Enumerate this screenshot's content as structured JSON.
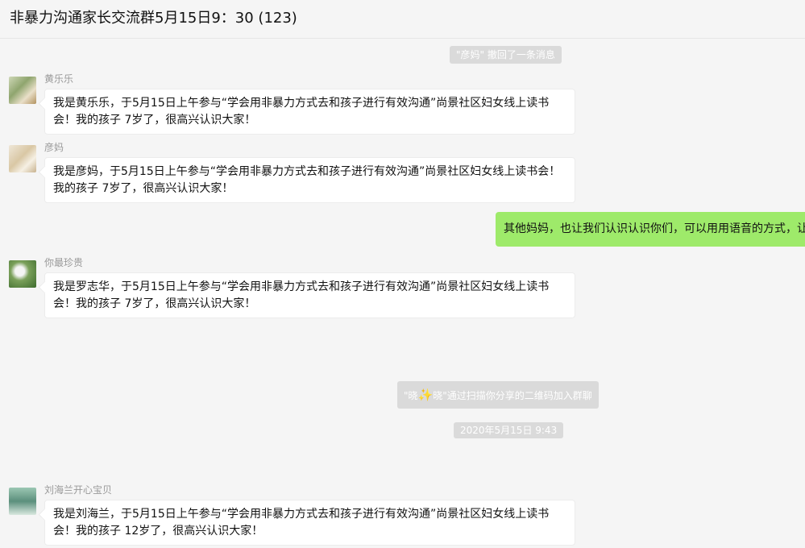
{
  "header": {
    "title": "非暴力沟通家长交流群5月15日9：30 (123)"
  },
  "notices": {
    "recall": "\"彦妈\" 撤回了一条消息",
    "join_prefix": "\"晓",
    "join_icon": "✨",
    "join_suffix": "晓\"通过扫描你分享的二维码加入群聊",
    "timestamp": "2020年5月15日 9:43"
  },
  "messages": [
    {
      "sender": "黄乐乐",
      "avatar": "avatar-photo",
      "text": "我是黄乐乐，于5月15日上午参与“学会用非暴力方式去和孩子进行有效沟通”尚景社区妇女线上读书会！我的孩子 7岁了，很高兴认识大家！"
    },
    {
      "sender": "彦妈",
      "avatar": "avatar-photo",
      "text": "我是彦妈，于5月15日上午参与“学会用非暴力方式去和孩子进行有效沟通”尚景社区妇女线上读书会！我的孩子 7岁了，很高兴认识大家！"
    },
    {
      "sender": "你最珍贵",
      "avatar": "avatar-photo",
      "text": "我是罗志华，于5月15日上午参与“学会用非暴力方式去和孩子进行有效沟通”尚景社区妇女线上读书会！我的孩子 7岁了，很高兴认识大家！"
    },
    {
      "sender": "刘海兰开心宝贝",
      "avatar": "avatar-photo",
      "text": "我是刘海兰，于5月15日上午参与“学会用非暴力方式去和孩子进行有效沟通”尚景社区妇女线上读书会！我的孩子 12岁了，很高兴认识大家！"
    }
  ],
  "my_message": {
    "text": "其他妈妈，也让我们认识认识你们，可以用用语音的方式，让"
  },
  "colors": {
    "my_bubble": "#9eea6a",
    "background": "#f5f5f5",
    "notice": "#dadada"
  }
}
